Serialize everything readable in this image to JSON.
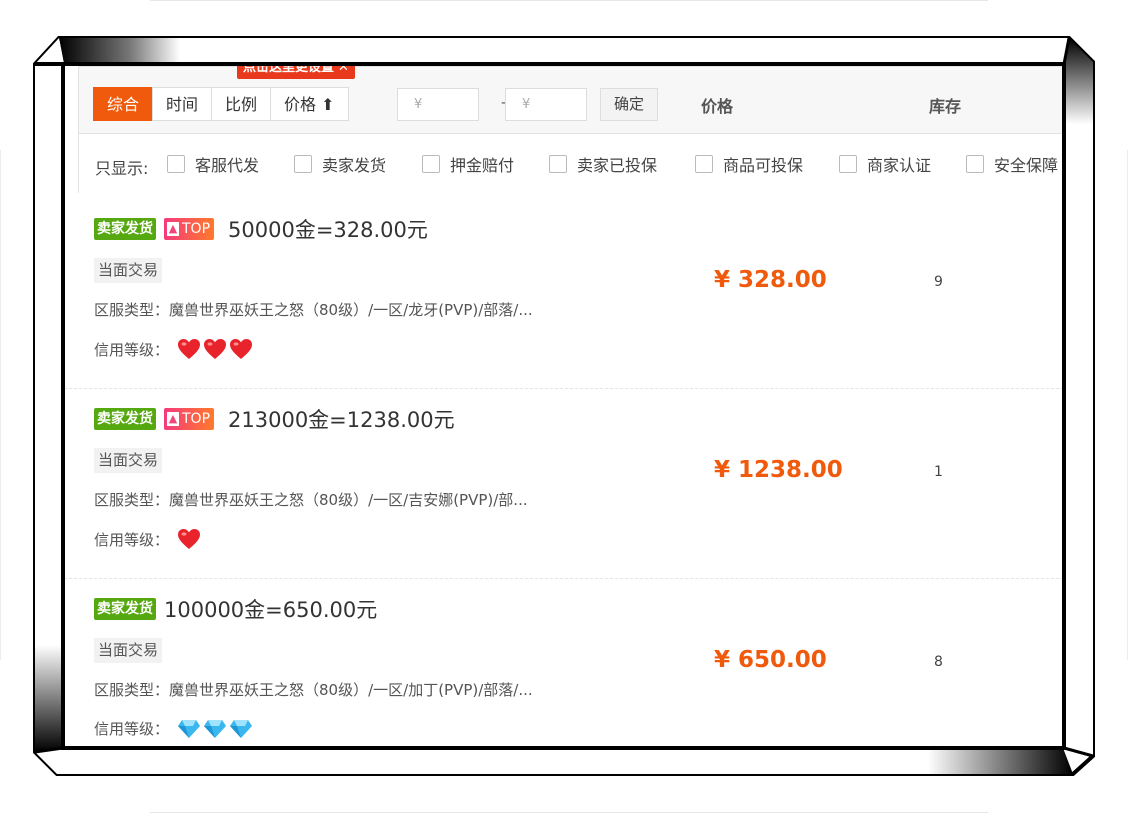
{
  "toolbar": {
    "tip": "点击这里更设置",
    "tip_close": "✕",
    "sort_buttons": [
      "综合",
      "时间",
      "比例",
      "价格 ⬆"
    ],
    "price_min_placeholder": "¥",
    "price_max_placeholder": "¥",
    "range_dash": "-",
    "confirm": "确定",
    "col_price": "价格",
    "col_stock": "库存"
  },
  "filters": {
    "label": "只显示:",
    "options": [
      "客服代发",
      "卖家发货",
      "押金赔付",
      "卖家已投保",
      "商品可投保",
      "商家认证",
      "安全保障"
    ]
  },
  "listings": [
    {
      "seller_badge": "卖家发货",
      "top_badge": "TOP",
      "title": "50000金=328.00元",
      "trade_tag": "当面交易",
      "server": "区服类型：魔兽世界巫妖王之怒（80级）/一区/龙牙(PVP)/部落/...",
      "credit_label": "信用等级：",
      "credit_type": "heart",
      "credit_count": 3,
      "price": "¥ 328.00",
      "stock": "9"
    },
    {
      "seller_badge": "卖家发货",
      "top_badge": "TOP",
      "title": "213000金=1238.00元",
      "trade_tag": "当面交易",
      "server": "区服类型：魔兽世界巫妖王之怒（80级）/一区/吉安娜(PVP)/部...",
      "credit_label": "信用等级：",
      "credit_type": "heart",
      "credit_count": 1,
      "price": "¥ 1238.00",
      "stock": "1"
    },
    {
      "seller_badge": "卖家发货",
      "top_badge": "",
      "title": "100000金=650.00元",
      "trade_tag": "当面交易",
      "server": "区服类型：魔兽世界巫妖王之怒（80级）/一区/加丁(PVP)/部落/...",
      "credit_label": "信用等级：",
      "credit_type": "diamond",
      "credit_count": 3,
      "price": "¥ 650.00",
      "stock": "8"
    }
  ],
  "colors": {
    "accent": "#f05a0c",
    "seller_badge": "#55a810",
    "top_badge": "#f43a7c",
    "heart": "#e8232b",
    "diamond": "#3bb7ef"
  }
}
